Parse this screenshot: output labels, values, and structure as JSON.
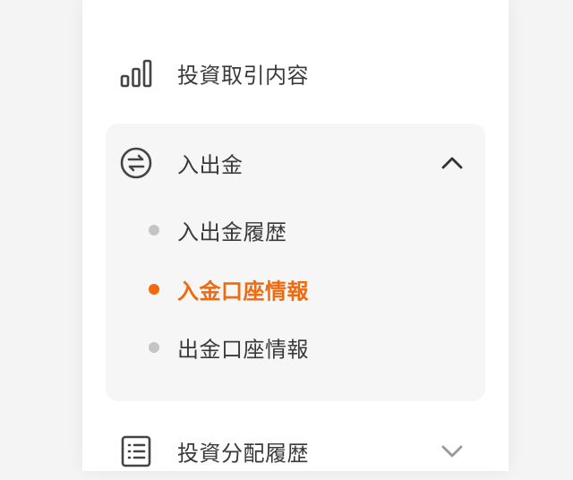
{
  "menu": {
    "investment": {
      "label": "投資取引内容",
      "icon": "bar-chart-icon"
    },
    "deposit_withdrawal": {
      "label": "入出金",
      "icon": "exchange-icon",
      "expanded": true,
      "children": [
        {
          "label": "入出金履歴",
          "active": false
        },
        {
          "label": "入金口座情報",
          "active": true
        },
        {
          "label": "出金口座情報",
          "active": false
        }
      ]
    },
    "distribution": {
      "label": "投資分配履歴",
      "icon": "list-icon",
      "expanded": false
    }
  },
  "colors": {
    "accent": "#f06a0f",
    "text": "#3a3a3a",
    "muted_dot": "#c4c4c4",
    "group_bg": "#f6f6f6"
  }
}
